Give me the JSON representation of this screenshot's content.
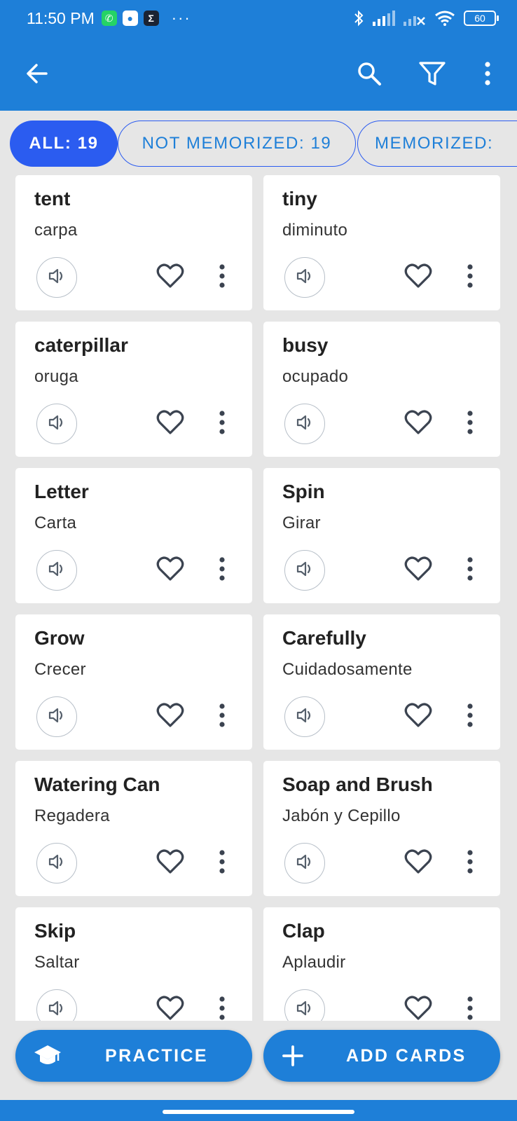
{
  "status_bar": {
    "time": "11:50 PM",
    "more": "···",
    "battery": "60",
    "notification_icons": [
      "whatsapp-icon",
      "message-icon",
      "sigma-icon"
    ],
    "system_icons": [
      "bluetooth-icon",
      "signal-icon",
      "signal-off-icon",
      "wifi-icon",
      "battery-icon"
    ]
  },
  "app_bar": {
    "icons": [
      "back-arrow-icon",
      "search-icon",
      "filter-icon",
      "more-vert-icon"
    ]
  },
  "filters": {
    "all": "ALL: 19",
    "not_memorized": "NOT MEMORIZED: 19",
    "memorized": "MEMORIZED:"
  },
  "cards": [
    {
      "word": "tent",
      "translation": "carpa"
    },
    {
      "word": "tiny",
      "translation": "diminuto"
    },
    {
      "word": "caterpillar",
      "translation": "oruga"
    },
    {
      "word": "busy",
      "translation": "ocupado"
    },
    {
      "word": "Letter",
      "translation": "Carta"
    },
    {
      "word": "Spin",
      "translation": "Girar"
    },
    {
      "word": "Grow",
      "translation": "Crecer"
    },
    {
      "word": "Carefully",
      "translation": "Cuidadosamente"
    },
    {
      "word": "Watering Can",
      "translation": "Regadera"
    },
    {
      "word": "Soap and Brush",
      "translation": "Jabón y Cepillo"
    },
    {
      "word": "Skip",
      "translation": "Saltar"
    },
    {
      "word": "Clap",
      "translation": "Aplaudir"
    }
  ],
  "bottom": {
    "practice": "PRACTICE",
    "add_cards": "ADD CARDS"
  },
  "colors": {
    "primary": "#1e7fd8",
    "chip_active": "#2b5cf0",
    "background": "#e6e6e6",
    "card": "#ffffff"
  }
}
